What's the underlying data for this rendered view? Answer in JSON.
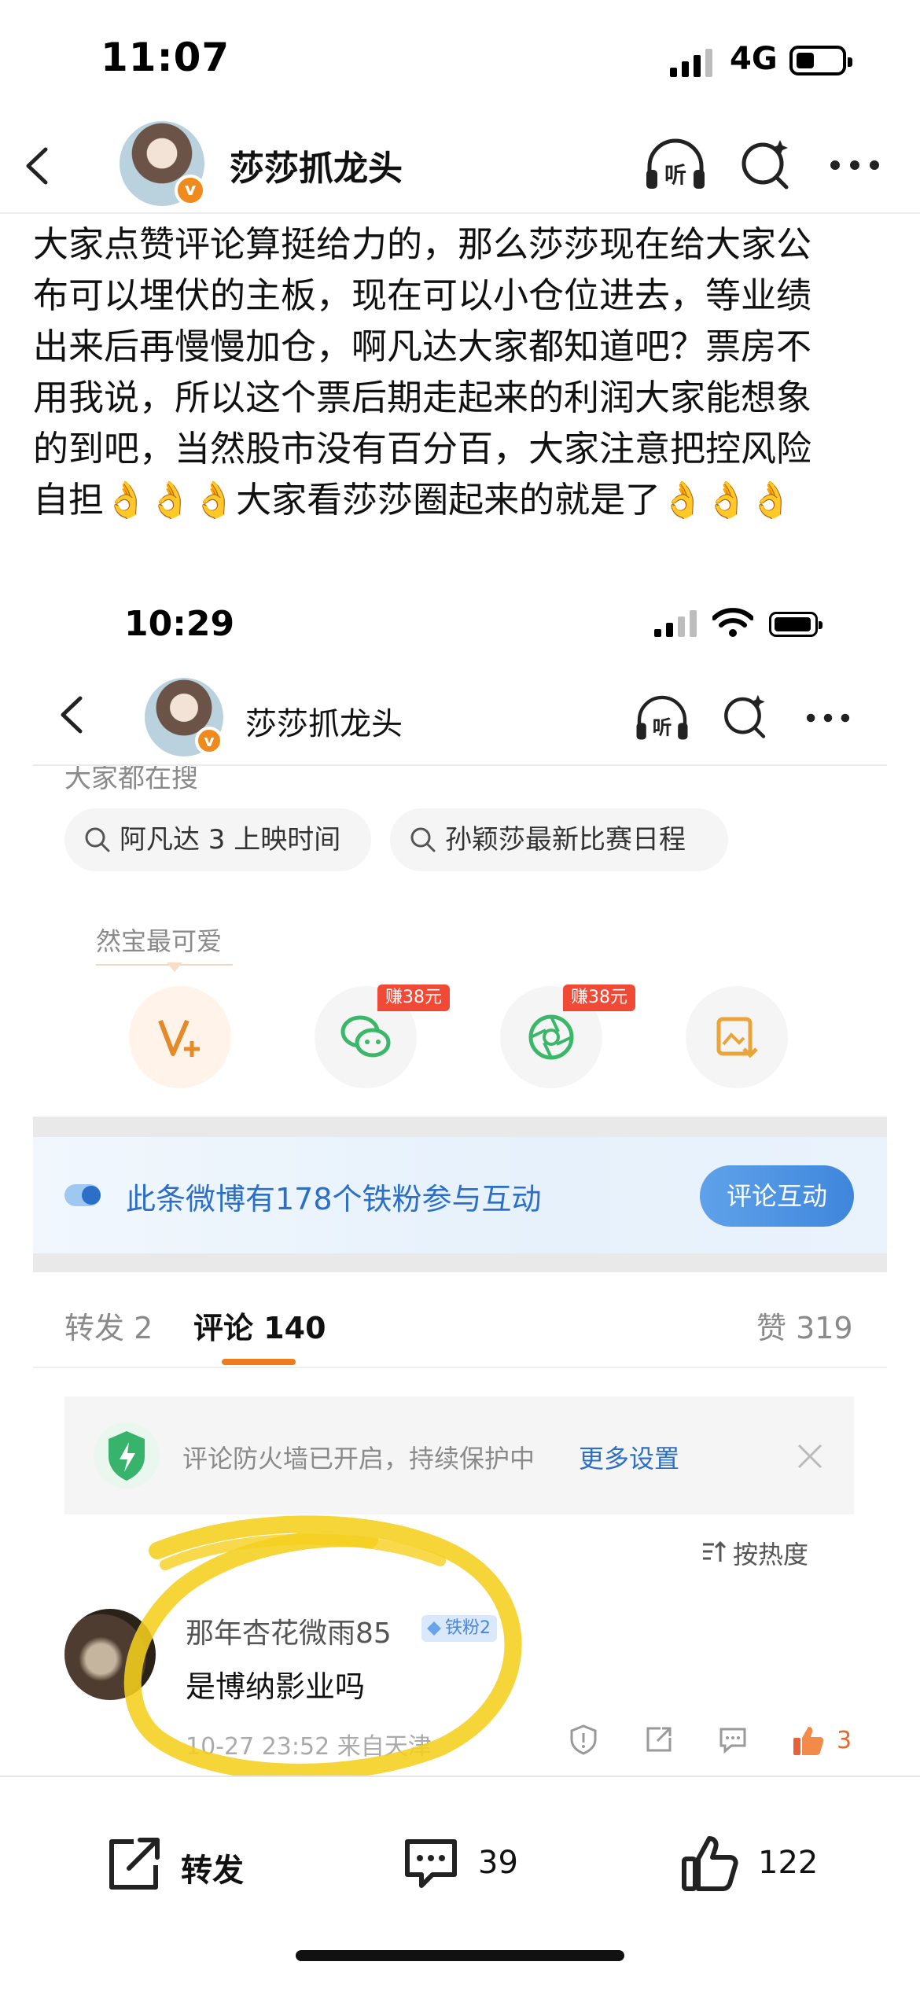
{
  "status_bar": {
    "time": "11:07",
    "network": "4G"
  },
  "header": {
    "title": "莎莎抓龙头",
    "verified": "v"
  },
  "post": {
    "lines": [
      "大家点赞评论算挺给力的，那么莎莎现在给大家公",
      "布可以埋伏的主板，现在可以小仓位进去，等业绩",
      "出来后再慢慢加仓，啊凡达大家都知道吧？票房不",
      "用我说，所以这个票后期走起来的利润大家能想象",
      "的到吧，当然股市没有百分百，大家注意把控风险",
      "自担👌👌👌大家看莎莎圈起来的就是了👌👌👌"
    ]
  },
  "inner": {
    "status_time": "10:29",
    "title": "莎莎抓龙头",
    "search_hint": "大家都在搜",
    "chips": [
      "阿凡达 3 上映时间",
      "孙颖莎最新比赛日程"
    ],
    "ranbao": "然宝最可爱",
    "earn_badges": [
      "赚38元",
      "赚38元"
    ],
    "fan_banner": {
      "text": "此条微博有178个铁粉参与互动",
      "button": "评论互动"
    },
    "tabs": {
      "repost": "转发 2",
      "comments": "评论 140",
      "likes": "赞 319"
    },
    "firewall": {
      "text": "评论防火墙已开启，持续保护中",
      "more": "更多设置"
    },
    "sort": "按热度",
    "comment": {
      "user": "那年杏花微雨85",
      "badge": "铁粉2",
      "text": "是博纳影业吗",
      "meta": "10-27 23:52  来自天津",
      "likes": "3"
    }
  },
  "bottom_bar": {
    "repost": "转发",
    "comment_count": "39",
    "like_count": "122"
  },
  "colors": {
    "accent": "#f07b1c",
    "link": "#2b6fc8",
    "highlight_circle": "#f5cf1e"
  }
}
